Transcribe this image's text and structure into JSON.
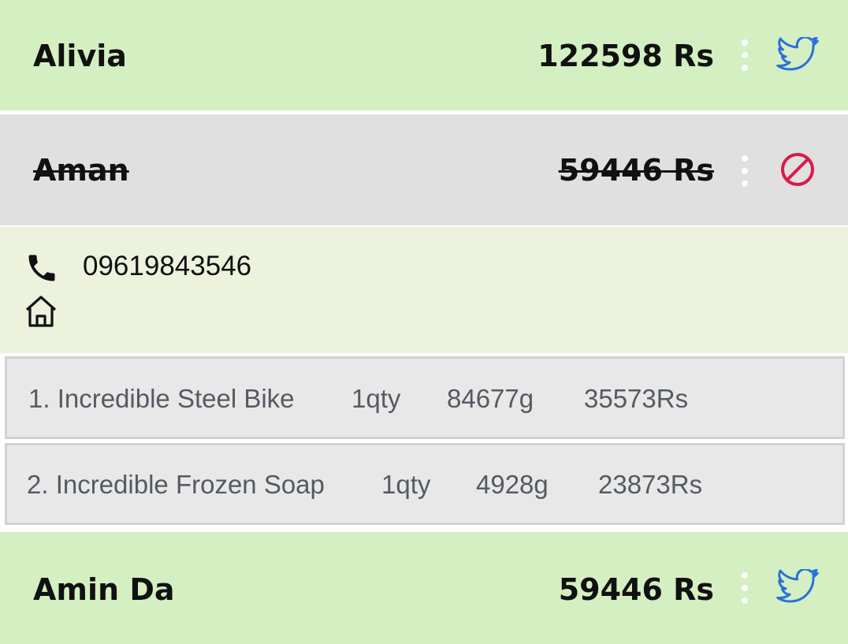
{
  "orders": [
    {
      "name": "Alivia",
      "amount": "122598 Rs",
      "status": "active",
      "status_icon": "twitter-icon",
      "row_color": "#d4efc1"
    },
    {
      "name": "Aman",
      "amount": "59446 Rs",
      "status": "cancelled",
      "status_icon": "block-icon",
      "row_color": "#e0e0e0",
      "expanded": true,
      "details": {
        "phone": "09619843546",
        "address": ""
      },
      "items": [
        {
          "label": "1. Incredible Steel Bike",
          "qty": "1qty",
          "weight": "84677g",
          "price": "35573Rs"
        },
        {
          "label": "2. Incredible Frozen Soap",
          "qty": "1qty",
          "weight": "4928g",
          "price": "23873Rs"
        }
      ]
    },
    {
      "name": "Amin Da",
      "amount": "59446 Rs",
      "status": "active",
      "status_icon": "twitter-icon",
      "row_color": "#d4efc1"
    }
  ],
  "colors": {
    "active_row": "#d4efc1",
    "cancelled_row": "#e0e0e0",
    "details_bg": "#edf2dd",
    "twitter_blue": "#2a6fdb",
    "block_red": "#d81b4a"
  }
}
